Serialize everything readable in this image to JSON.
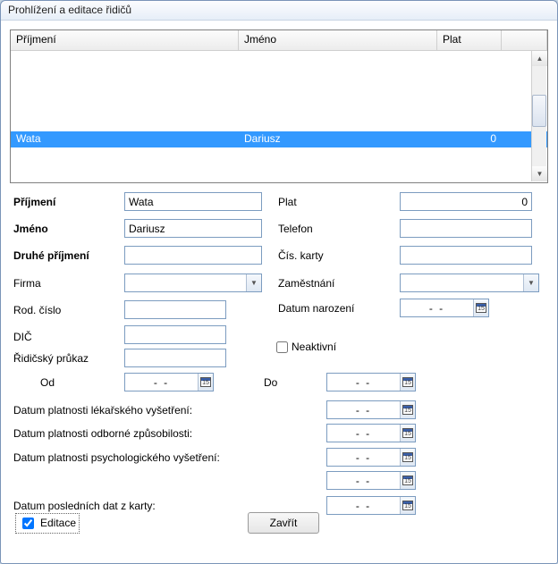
{
  "window": {
    "title": "Prohlížení a editace řidičů"
  },
  "grid": {
    "headers": {
      "surname": "Příjmení",
      "name": "Jméno",
      "salary": "Plat"
    },
    "rows": [
      {
        "surname": "Wata",
        "name": "Dariusz",
        "salary": "0",
        "selected": true
      }
    ]
  },
  "labels": {
    "prijmeni": "Příjmení",
    "jmeno": "Jméno",
    "druhe_prijmeni": "Druhé příjmení",
    "firma": "Firma",
    "rod_cislo": "Rod. číslo",
    "dic": "DIČ",
    "ridicsky_prukaz": "Řidičský průkaz",
    "od": "Od",
    "plat": "Plat",
    "telefon": "Telefon",
    "cis_karty": "Čís. karty",
    "zamestnani": "Zaměstnání",
    "datum_narozeni": "Datum narození",
    "neaktivni": "Neaktivní",
    "do": "Do",
    "lek": "Datum platnosti lékařského vyšetření:",
    "odborne": "Datum platnosti odborné způsobilosti:",
    "psych": "Datum platnosti psychologického vyšetření:",
    "posledni": "Datum posledních dat z karty:"
  },
  "values": {
    "prijmeni": "Wata",
    "jmeno": "Dariusz",
    "druhe_prijmeni": "",
    "firma": "",
    "rod_cislo": "",
    "dic": "",
    "ridicsky_prukaz": "",
    "plat": "0",
    "telefon": "",
    "cis_karty": "",
    "zamestnani": "",
    "date_empty": "-   -",
    "neaktivni_checked": false,
    "editace_checked": true
  },
  "buttons": {
    "zavrit": "Zavřít",
    "editace": "Editace"
  }
}
